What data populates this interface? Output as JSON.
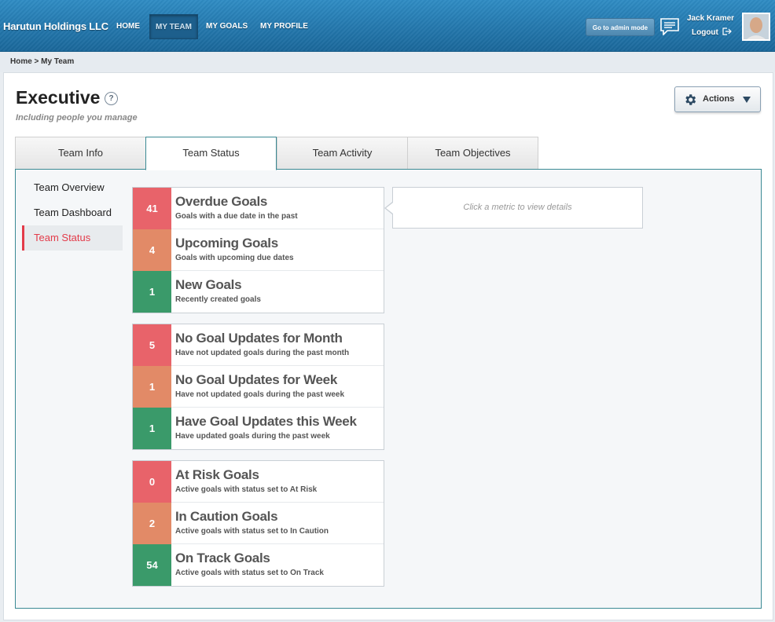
{
  "app": {
    "brand": "Harutun Holdings LLC",
    "nav": [
      {
        "label": "HOME"
      },
      {
        "label": "MY TEAM"
      },
      {
        "label": "MY GOALS"
      },
      {
        "label": "MY PROFILE"
      }
    ],
    "admin_button": "Go to admin mode",
    "user_name": "Jack Kramer",
    "logout": "Logout"
  },
  "breadcrumb": "Home > My Team",
  "page": {
    "title": "Executive",
    "help": "?",
    "subtitle": "Including people you manage",
    "actions_label": "Actions"
  },
  "tabs": [
    {
      "label": "Team Info"
    },
    {
      "label": "Team Status"
    },
    {
      "label": "Team Activity"
    },
    {
      "label": "Team Objectives"
    }
  ],
  "sidebar": [
    {
      "label": "Team Overview"
    },
    {
      "label": "Team Dashboard"
    },
    {
      "label": "Team Status"
    }
  ],
  "colors": {
    "red": "#e8636a",
    "orange": "#e28a67",
    "green": "#3a9a6a",
    "accent": "#e33b4a"
  },
  "groups": [
    {
      "metrics": [
        {
          "value": "41",
          "title": "Overdue Goals",
          "desc": "Goals with a due date in the past",
          "status": "red"
        },
        {
          "value": "4",
          "title": "Upcoming Goals",
          "desc": "Goals with upcoming due dates",
          "status": "orange"
        },
        {
          "value": "1",
          "title": "New Goals",
          "desc": "Recently created goals",
          "status": "green"
        }
      ]
    },
    {
      "metrics": [
        {
          "value": "5",
          "title": "No Goal Updates for Month",
          "desc": "Have not updated goals during the past month",
          "status": "red"
        },
        {
          "value": "1",
          "title": "No Goal Updates for Week",
          "desc": "Have not updated goals during the past week",
          "status": "orange"
        },
        {
          "value": "1",
          "title": "Have Goal Updates this Week",
          "desc": "Have updated goals during the past week",
          "status": "green"
        }
      ]
    },
    {
      "metrics": [
        {
          "value": "0",
          "title": "At Risk Goals",
          "desc": "Active goals with status set to At Risk",
          "status": "red"
        },
        {
          "value": "2",
          "title": "In Caution Goals",
          "desc": "Active goals with status set to In Caution",
          "status": "orange"
        },
        {
          "value": "54",
          "title": "On Track Goals",
          "desc": "Active goals with status set to On Track",
          "status": "green"
        }
      ]
    }
  ],
  "detail_placeholder": "Click a metric to view details"
}
